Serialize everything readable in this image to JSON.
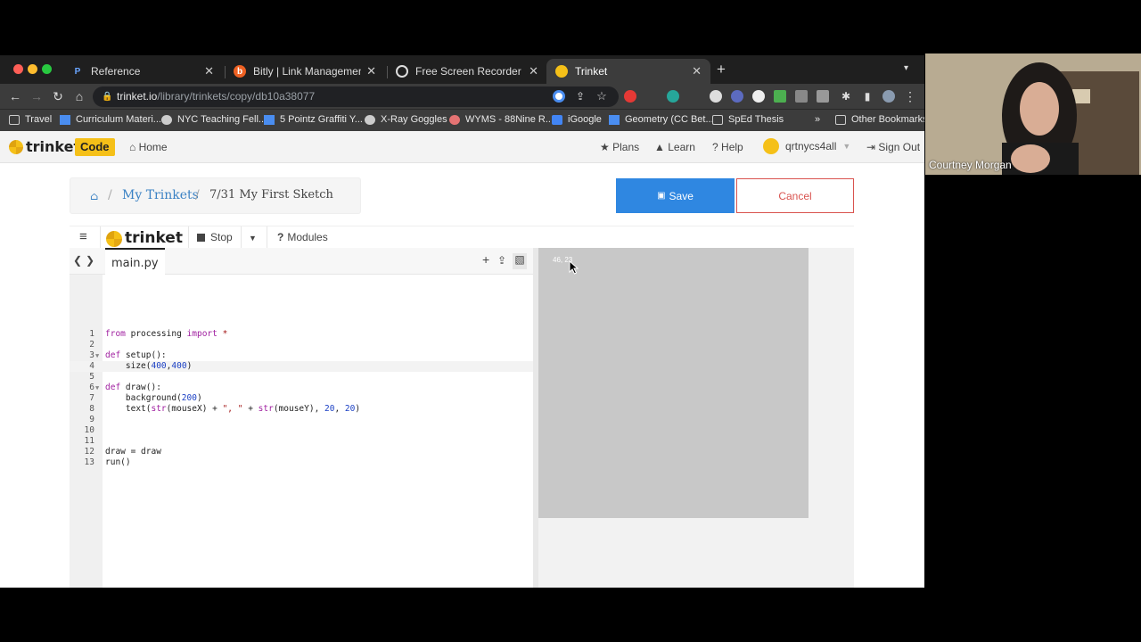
{
  "browser": {
    "tabs": [
      {
        "title": "Reference",
        "icon_text": "P"
      },
      {
        "title": "Bitly | Link Management",
        "icon_text": "b"
      },
      {
        "title": "Free Screen Recorder - No Ac",
        "icon_text": ""
      },
      {
        "title": "Trinket",
        "icon_text": ""
      }
    ],
    "url_host": "trinket.io",
    "url_path": "/library/trinkets/copy/db10a38077",
    "bookmarks": [
      "Travel",
      "Curriculum Materi...",
      "NYC Teaching Fell...",
      "5 Pointz Graffiti Y...",
      "X-Ray Goggles",
      "WYMS - 88Nine R...",
      "iGoogle",
      "Geometry (CC Bet...",
      "SpEd Thesis"
    ],
    "bookmarks_overflow": "»",
    "other_bookmarks": "Other Bookmarks"
  },
  "header": {
    "logo": "trinket",
    "badge": "Code",
    "home": "Home",
    "plans": "Plans",
    "learn": "Learn",
    "help": "Help",
    "user": "qrtnycs4all",
    "sign_out": "Sign Out"
  },
  "breadcrumb": {
    "parent": "My Trinkets",
    "current": "7/31 My First Sketch"
  },
  "actions": {
    "save": "Save",
    "cancel": "Cancel"
  },
  "editor_toolbar": {
    "logo": "trinket",
    "stop": "Stop",
    "modules": "Modules"
  },
  "editor": {
    "filename": "main.py",
    "lines": [
      "1",
      "2",
      "3",
      "4",
      "5",
      "6",
      "7",
      "8",
      "9",
      "10",
      "11",
      "12",
      "13"
    ]
  },
  "output": {
    "canvas_text": "46, 23"
  },
  "webcam": {
    "name": "Courtney Morgan"
  }
}
